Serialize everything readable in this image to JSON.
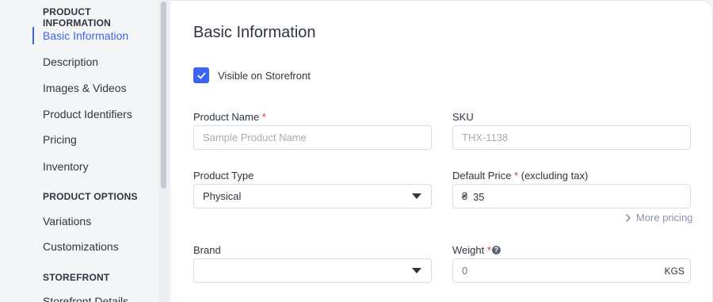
{
  "sidebar": {
    "sections": [
      {
        "title": "PRODUCT INFORMATION"
      },
      {
        "title": "PRODUCT OPTIONS"
      },
      {
        "title": "STOREFRONT"
      }
    ],
    "items": [
      {
        "label": "Basic Information",
        "active": true
      },
      {
        "label": "Description"
      },
      {
        "label": "Images & Videos"
      },
      {
        "label": "Product Identifiers"
      },
      {
        "label": "Pricing"
      },
      {
        "label": "Inventory"
      },
      {
        "label": "Variations"
      },
      {
        "label": "Customizations"
      },
      {
        "label": "Storefront Details"
      }
    ]
  },
  "main": {
    "title": "Basic Information",
    "visible_checkbox": {
      "label": "Visible on Storefront",
      "checked": true
    },
    "product_name": {
      "label": "Product Name",
      "required_mark": "*",
      "placeholder": "Sample Product Name",
      "value": ""
    },
    "sku": {
      "label": "SKU",
      "placeholder": "THX-1138",
      "value": ""
    },
    "product_type": {
      "label": "Product Type",
      "value": "Physical"
    },
    "default_price": {
      "label": "Default Price",
      "required_mark": "*",
      "suffix_label": "(excluding tax)",
      "currency": "₴",
      "value": "35"
    },
    "more_pricing": {
      "icon": "chevron-right-icon",
      "label": "More pricing"
    },
    "brand": {
      "label": "Brand",
      "value": ""
    },
    "weight": {
      "label": "Weight",
      "required_mark": "*",
      "help_icon": "?",
      "placeholder": "0",
      "unit": "KGS"
    }
  },
  "colors": {
    "accent": "#3c64f4",
    "required": "#db3643",
    "text": "#313440",
    "muted": "#8c93ad"
  }
}
